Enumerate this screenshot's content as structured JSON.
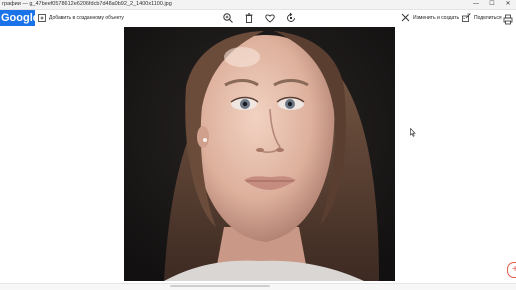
{
  "window": {
    "title": "графии — g_47beef0578612e6206fdcb7d48a0b92_2_1400x1100.jpg",
    "minimize_glyph": "—",
    "maximize_glyph": "☐",
    "close_glyph": "✕"
  },
  "toolbar": {
    "brand_text": "Google",
    "add_to_album_label": "Добавить в созданному объекту",
    "icons": [
      "zoom-in-icon",
      "trash-icon",
      "heart-icon",
      "rotate-icon"
    ],
    "edit_create_label": "Изменить и создать",
    "share_label": "Поделиться"
  },
  "viewer": {
    "fab_glyph": "+"
  },
  "colors": {
    "accent": "#1a73e8",
    "fab_border": "#e05a4a"
  }
}
